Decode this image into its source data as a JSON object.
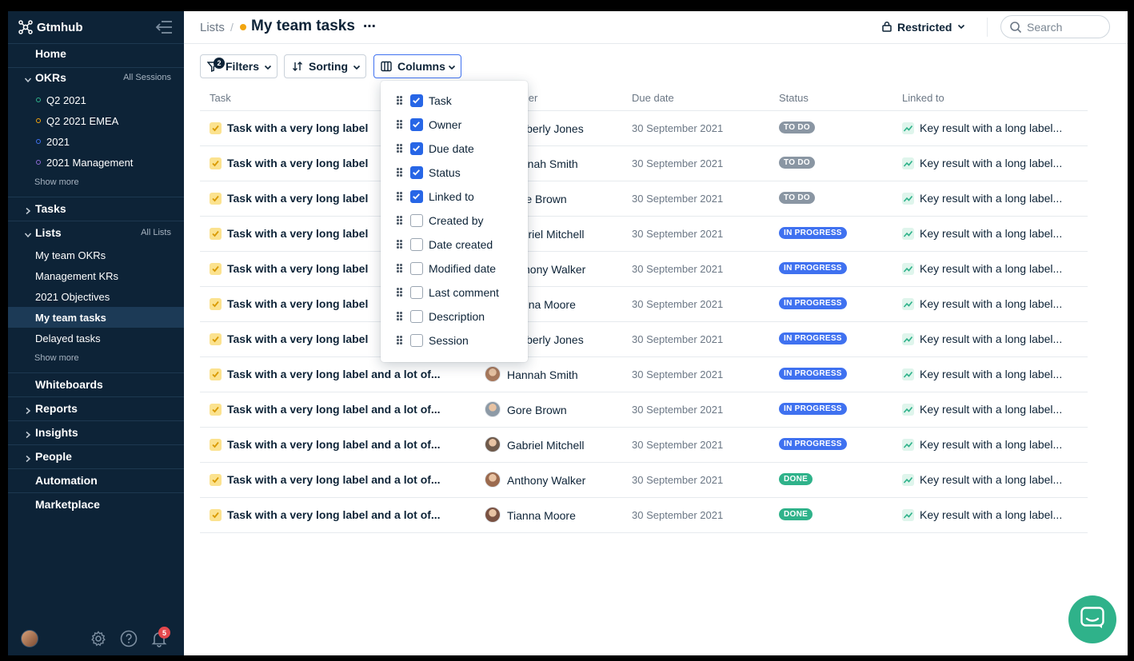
{
  "app": {
    "name": "Gtmhub"
  },
  "sidebar": {
    "home": "Home",
    "okrs": {
      "label": "OKRs",
      "aux": "All Sessions",
      "items": [
        {
          "label": "Q2 2021",
          "color": "#2fb28a"
        },
        {
          "label": "Q2 2021 EMEA",
          "color": "#f2a50f"
        },
        {
          "label": "2021",
          "color": "#3f71f0"
        },
        {
          "label": "2021 Management",
          "color": "#8e6bd6"
        }
      ],
      "show_more": "Show more"
    },
    "tasks": "Tasks",
    "lists": {
      "label": "Lists",
      "aux": "All Lists",
      "items": [
        "My team OKRs",
        "Management KRs",
        "2021 Objectives",
        "My team tasks",
        "Delayed tasks"
      ],
      "show_more": "Show more"
    },
    "whiteboards": "Whiteboards",
    "reports": "Reports",
    "insights": "Insights",
    "people": "People",
    "automation": "Automation",
    "marketplace": "Marketplace",
    "notifications_count": "5"
  },
  "header": {
    "breadcrumb": "Lists",
    "separator": "/",
    "title": "My team tasks",
    "more": "⋯",
    "access": "Restricted",
    "search_placeholder": "Search"
  },
  "toolbar": {
    "filters": "Filters",
    "filters_count": "2",
    "sorting": "Sorting",
    "columns": "Columns"
  },
  "table": {
    "headers": {
      "task": "Task",
      "owner": "Owner",
      "due": "Due date",
      "status": "Status",
      "linked": "Linked to"
    },
    "rows": [
      {
        "task": "Task with a very long label",
        "owner": "Kimberly Jones",
        "due": "30 September 2021",
        "status": "TO DO",
        "linked": "Key result with a long label..."
      },
      {
        "task": "Task with a very long label",
        "owner": "Hannah Smith",
        "due": "30 September 2021",
        "status": "TO DO",
        "linked": "Key result with a long label..."
      },
      {
        "task": "Task with a very long label",
        "owner": "Gore Brown",
        "due": "30 September 2021",
        "status": "TO DO",
        "linked": "Key result with a long label..."
      },
      {
        "task": "Task with a very long label",
        "owner": "Gabriel Mitchell",
        "due": "30 September 2021",
        "status": "IN PROGRESS",
        "linked": "Key result with a long label..."
      },
      {
        "task": "Task with a very long label",
        "owner": "Anthony Walker",
        "due": "30 September 2021",
        "status": "IN PROGRESS",
        "linked": "Key result with a long label..."
      },
      {
        "task": "Task with a very long label",
        "owner": "Tianna Moore",
        "due": "30 September 2021",
        "status": "IN PROGRESS",
        "linked": "Key result with a long label..."
      },
      {
        "task": "Task with a very long label",
        "owner": "Kimberly Jones",
        "due": "30 September 2021",
        "status": "IN PROGRESS",
        "linked": "Key result with a long label..."
      },
      {
        "task": "Task with a very long label and a lot of...",
        "owner": "Hannah Smith",
        "due": "30 September 2021",
        "status": "IN PROGRESS",
        "linked": "Key result with a long label..."
      },
      {
        "task": "Task with a very long label and a lot of...",
        "owner": "Gore Brown",
        "due": "30 September 2021",
        "status": "IN PROGRESS",
        "linked": "Key result with a long label..."
      },
      {
        "task": "Task with a very long label and a lot of...",
        "owner": "Gabriel Mitchell",
        "due": "30 September 2021",
        "status": "IN PROGRESS",
        "linked": "Key result with a long label..."
      },
      {
        "task": "Task with a very long label and a lot of...",
        "owner": "Anthony Walker",
        "due": "30 September 2021",
        "status": "DONE",
        "linked": "Key result with a long label..."
      },
      {
        "task": "Task with a very long label and a lot of...",
        "owner": "Tianna Moore",
        "due": "30 September 2021",
        "status": "DONE",
        "linked": "Key result with a long label..."
      }
    ]
  },
  "status_colors": {
    "TO DO": "#8a96a3",
    "IN PROGRESS": "#3f71f0",
    "DONE": "#2fb28a"
  },
  "columns_menu": [
    {
      "label": "Task",
      "checked": true
    },
    {
      "label": "Owner",
      "checked": true
    },
    {
      "label": "Due date",
      "checked": true
    },
    {
      "label": "Status",
      "checked": true
    },
    {
      "label": "Linked to",
      "checked": true
    },
    {
      "label": "Created by",
      "checked": false
    },
    {
      "label": "Date created",
      "checked": false
    },
    {
      "label": "Modified date",
      "checked": false
    },
    {
      "label": "Last comment",
      "checked": false
    },
    {
      "label": "Description",
      "checked": false
    },
    {
      "label": "Session",
      "checked": false
    }
  ]
}
